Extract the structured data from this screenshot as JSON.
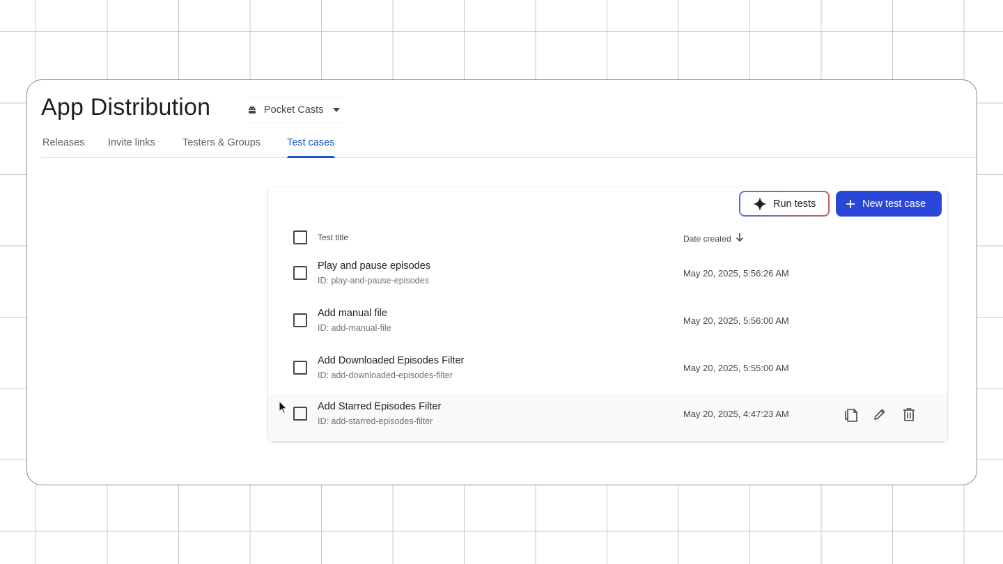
{
  "header": {
    "title": "App Distribution",
    "app_selector": {
      "icon": "android-icon",
      "label": "Pocket Casts"
    }
  },
  "tabs": [
    {
      "label": "Releases",
      "active": false
    },
    {
      "label": "Invite links",
      "active": false
    },
    {
      "label": "Testers & Groups",
      "active": false
    },
    {
      "label": "Test cases",
      "active": true
    }
  ],
  "toolbar": {
    "run_tests_label": "Run tests",
    "new_test_case_label": "New test case"
  },
  "table": {
    "columns": {
      "title": "Test title",
      "date": "Date created"
    },
    "rows": [
      {
        "title": "Play and pause episodes",
        "id": "ID: play-and-pause-episodes",
        "date": "May 20, 2025, 5:56:26 AM"
      },
      {
        "title": "Add manual file",
        "id": "ID: add-manual-file",
        "date": "May 20, 2025, 5:56:00 AM"
      },
      {
        "title": "Add Downloaded Episodes Filter",
        "id": "ID: add-downloaded-episodes-filter",
        "date": "May 20, 2025, 5:55:00 AM"
      },
      {
        "title": "Add Starred Episodes Filter",
        "id": "ID: add-starred-episodes-filter",
        "date": "May 20, 2025, 4:47:23 AM"
      }
    ],
    "hover_row_actions": [
      "copy-icon",
      "edit-icon",
      "delete-icon"
    ]
  },
  "colors": {
    "accent": "#1a56c4",
    "primary_button": "#2a48d8",
    "text": "#1f1f1f"
  }
}
